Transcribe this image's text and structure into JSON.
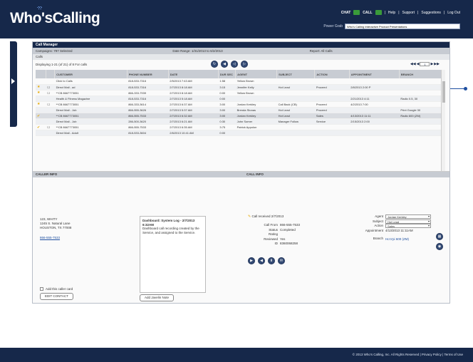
{
  "app": {
    "logo": "Who'sCalling"
  },
  "topnav": {
    "chat": "CHAT",
    "call": "CALL",
    "help": "Help",
    "support": "Support",
    "suggestions": "Suggestions",
    "logout": "Log Out"
  },
  "search": {
    "label": "Power Grab",
    "value": "Who's Calling Interactive Product Presentations"
  },
  "main": {
    "title": "Call Manager",
    "filters": {
      "campaigns": "Campaigns: 797 Selected",
      "date": "Date Range: 1/31/2013 to 6/2/2013",
      "report": "Report: All Calls"
    },
    "calls_label": "Calls",
    "showing": "Displaying 1-21 (of 21) of 8 For calls",
    "pager_value": "1"
  },
  "table": {
    "headers": [
      "",
      "",
      "CUSTOMER",
      "PHONE NUMBER",
      "DATE",
      "DUR SEC",
      "AGENT",
      "SUBJECT",
      "ACTION",
      "APPOINTMENT",
      "BRANCH"
    ],
    "rows": [
      [
        "",
        "",
        "Click to Calls",
        "818-533-7316",
        "2/5/2013 7:43 AM",
        "1:58",
        "Yellow Brown",
        "",
        "",
        "",
        ""
      ],
      [
        "★",
        "☐",
        "Direct Mail - ad",
        "818-533-7316",
        "2/7/2013 8:18 AM",
        "3:15",
        "Jennifer Kelly",
        "Hot Lead",
        "Proceed",
        "2/8/2013 2:00 P",
        ""
      ],
      [
        "★",
        "☐",
        "**CB 8667773051",
        "866-333-7939",
        "2/7/2013 8:18 AM",
        "0:00",
        "Yellow Brown",
        "",
        "",
        "",
        ""
      ],
      [
        "",
        "",
        "Health & Fitness Magazine",
        "818-533-7316",
        "2/7/2013 5:18 AM",
        "0:00",
        "",
        "",
        "",
        "2/21/2013 4:11",
        "Radio 0.5, 30"
      ],
      [
        "★",
        "☐",
        "**CB 8667773051",
        "866-333-3614",
        "2/7/2013 6:37 AM",
        "3:00",
        "Jordan Kerkley",
        "Call Back (CB)",
        "Proceed",
        "4/2/2013 7:00",
        ""
      ],
      [
        "",
        "",
        "Direct Mail - Job",
        "866-555-3626",
        "2/7/2013 5:37 AM",
        "3:00",
        "Brenda Stonas",
        "Hot Lead",
        "Proceed",
        "",
        "Print Google 30"
      ],
      [
        "✔",
        "",
        "**CB 8667773051",
        "866-555-7533",
        "2/7/2013 6:32 AM",
        "3:00",
        "Jordan Kerkley",
        "Hot Lead",
        "Sales",
        "4/13/2013 11:11",
        "Radio 600 (ZM)"
      ],
      [
        "",
        "",
        "Direct Mail - Job",
        "286-500-3620",
        "2/7/2013 6:21 AM",
        "0:30",
        "John Somer",
        "Manager Follow",
        "Service",
        "2/15/2013 2:00",
        ""
      ],
      [
        "✔",
        "☐",
        "**CB 8667773051",
        "866-555-7533",
        "2/7/2013 6:35 AM",
        "3:75",
        "Patrick Appolon",
        "",
        "",
        "",
        ""
      ],
      [
        "",
        "",
        "Direct Mail - Adult",
        "818-533-3604",
        "2/6/2013 10:41 AM",
        "0:00",
        "",
        "",
        "",
        "",
        ""
      ]
    ]
  },
  "caller": {
    "section": "CALLER INFO",
    "line1": "123, WHITY",
    "line2": "1245 S. Natural Lane",
    "line3": "HOUSTON, TX 77008",
    "phone": "866-555-7533",
    "notes_title": "Dashboard: System Log - 2/7/2013 6:32AM",
    "notes_body": "Dashboard call recording created by the Service, and assigned to the Service.",
    "checkbox": "Add this caller card",
    "edit": "EDIT CONTACT",
    "add_note": "Add Javelin Note"
  },
  "call": {
    "section": "CALL INFO",
    "title": "Call received 2/7/2013",
    "from_label": "Call From",
    "from_value": "866-555-7533",
    "status_label": "Status",
    "status_value": "Completed",
    "rating_label": "Rating",
    "reviewed_label": "Reviewed",
    "reviewed_value": "Yes",
    "id_label": "ID",
    "id_value": "8360068258",
    "agent_label": "Agent",
    "agent_value": "Jordan Kerkley",
    "subject_label": "Subject",
    "subject_value": "Hot Lead",
    "action_label": "Action",
    "action_value": "Sales",
    "appt_label": "Appointment",
    "appt_value": "4/13/2013 11:11AM",
    "branch_label": "Branch",
    "branch_value": "Ho'o'pi 600 (ZM)"
  },
  "footer": {
    "text": "© 2013 Who's Calling, Inc.  All Rights Reserved  |  Privacy Policy  |  Terms of Use"
  }
}
